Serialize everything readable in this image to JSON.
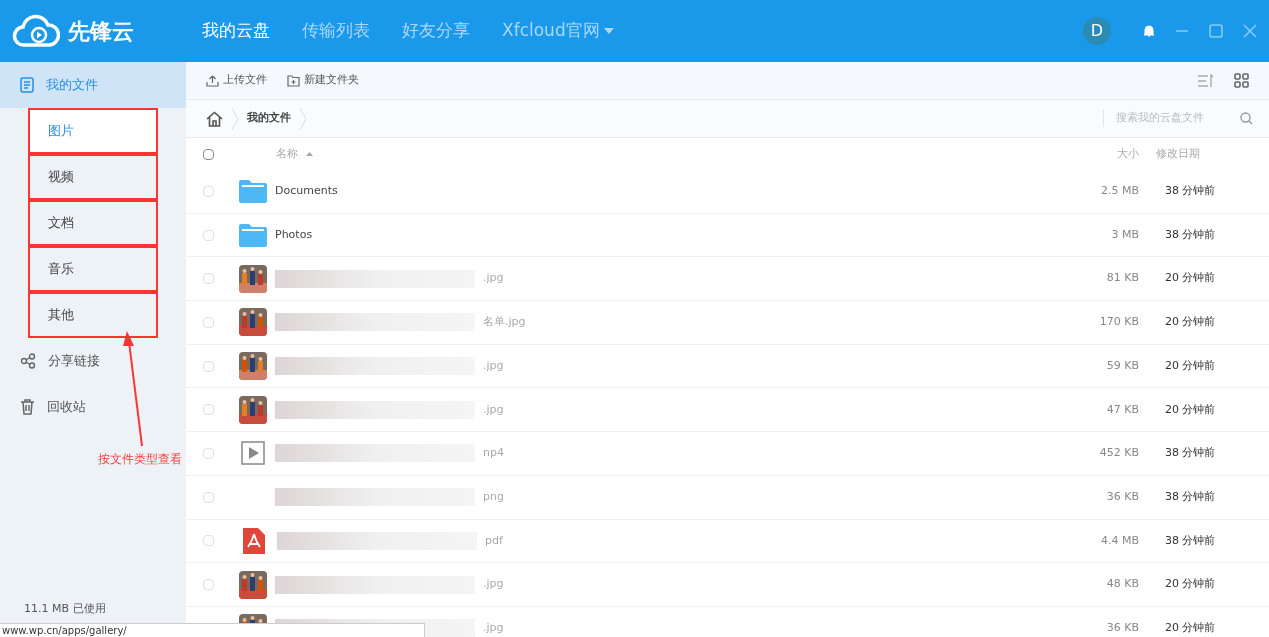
{
  "app": {
    "name": "先锋云"
  },
  "nav": [
    {
      "label": "我的云盘",
      "selected": true
    },
    {
      "label": "传输列表",
      "selected": false
    },
    {
      "label": "好友分享",
      "selected": false
    },
    {
      "label": "Xfcloud官网",
      "selected": false
    }
  ],
  "user": {
    "avatar": "D"
  },
  "sidebar": {
    "items": [
      {
        "label": "我的文件",
        "selected": true,
        "children": [
          {
            "label": "图片",
            "selected": true
          },
          {
            "label": "视频",
            "selected": false
          },
          {
            "label": "文档",
            "selected": false
          },
          {
            "label": "音乐",
            "selected": false
          },
          {
            "label": "其他",
            "selected": false
          }
        ]
      },
      {
        "label": "分享链接",
        "selected": false
      },
      {
        "label": "回收站",
        "selected": false
      }
    ],
    "usage": "11.1 MB 已使用"
  },
  "annotation": {
    "text": "按文件类型查看"
  },
  "toolbar": {
    "buttons": [
      {
        "label": "上传文件"
      },
      {
        "label": "新建文件夹"
      }
    ]
  },
  "breadcrumb": [
    "我的文件"
  ],
  "search": {
    "placeholder": "搜索我的云盘文件"
  },
  "table": {
    "all_checked": false,
    "columns": {
      "name": "名称",
      "size": "大小",
      "modified": "修改日期"
    },
    "rows": [
      {
        "kind": "folder",
        "name": "Documents",
        "size": "2.5 MB",
        "modified": "38 分钟前",
        "checked": false
      },
      {
        "kind": "folder",
        "name": "Photos",
        "size": "3 MB",
        "modified": "38 分钟前",
        "checked": false
      },
      {
        "name": ".jpg",
        "size": "81 KB",
        "modified": "20 分钟前",
        "checked": false
      },
      {
        "name": "名单.jpg",
        "size": "170 KB",
        "modified": "20 分钟前",
        "checked": false
      },
      {
        "name": ".jpg",
        "size": "59 KB",
        "modified": "20 分钟前",
        "checked": false
      },
      {
        "name": ".jpg",
        "size": "47 KB",
        "modified": "20 分钟前",
        "checked": false
      },
      {
        "kind": "video",
        "name": "np4",
        "size": "452 KB",
        "modified": "38 分钟前",
        "checked": false
      },
      {
        "name": "png",
        "size": "36 KB",
        "modified": "38 分钟前",
        "checked": false
      },
      {
        "kind": "pdf",
        "name": "pdf",
        "size": "4.4 MB",
        "modified": "38 分钟前",
        "checked": false
      },
      {
        "name": ".jpg",
        "size": "48 KB",
        "modified": "20 分钟前",
        "checked": false
      },
      {
        "name": ".jpg",
        "size": "36 KB",
        "modified": "20 分钟前"
      }
    ]
  },
  "status_bar": {
    "url": "www.wp.cn/apps/gallery/"
  }
}
